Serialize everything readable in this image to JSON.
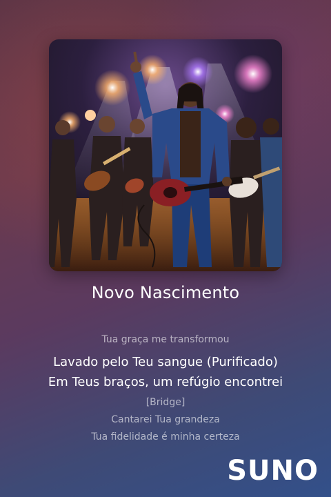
{
  "song": {
    "title": "Novo Nascimento"
  },
  "lyrics": [
    "Tua graça me transformou",
    "Lavado pelo Teu sangue (Purificado)",
    "Em Teus braços, um refúgio encontrei",
    "[Bridge]",
    "Cantarei Tua grandeza",
    "Tua fidelidade é minha certeza"
  ],
  "brand": {
    "logo_text": "SUNO"
  },
  "cover": {
    "icon": "band-concert-artwork"
  },
  "colors": {
    "background_top": "#5a3446",
    "background_bottom": "#33508a",
    "active_lyric": "#ffffff"
  }
}
